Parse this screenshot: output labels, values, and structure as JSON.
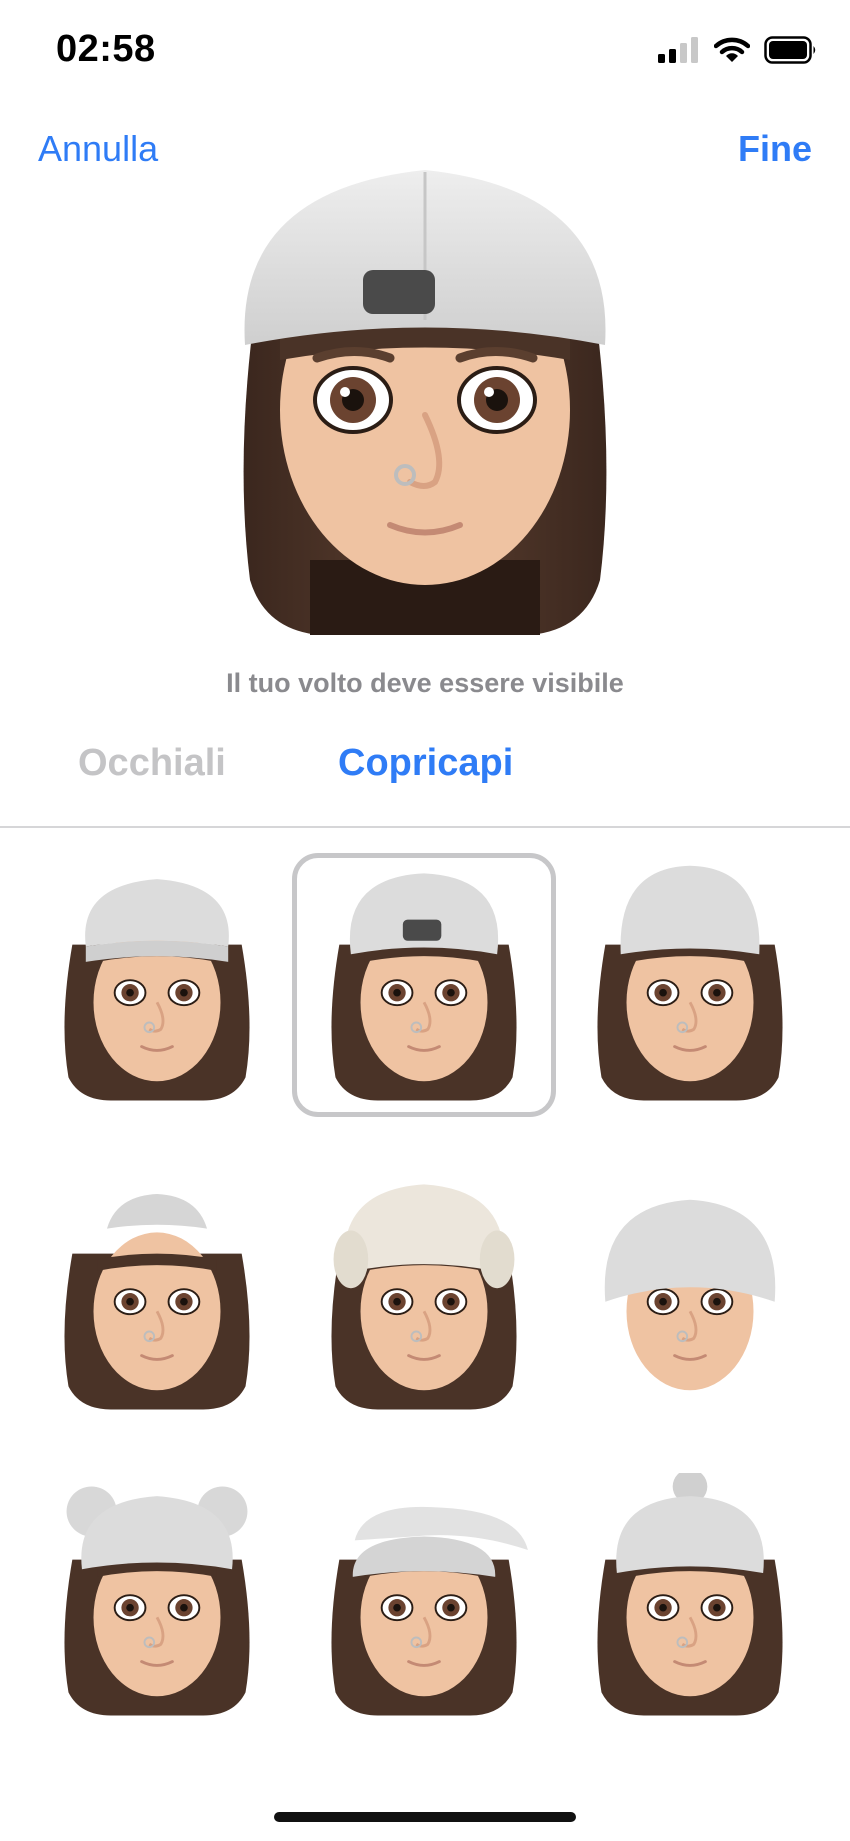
{
  "status_bar": {
    "time": "02:58",
    "signal_icon": "cellular-signal-icon",
    "wifi_icon": "wifi-icon",
    "battery_icon": "battery-icon"
  },
  "nav": {
    "cancel_label": "Annulla",
    "done_label": "Fine"
  },
  "preview": {
    "hint": "Il tuo volto deve essere visibile",
    "hat": "backwards-cap"
  },
  "tabs": [
    {
      "label": "Occhiali",
      "selected": false
    },
    {
      "label": "Copricapi",
      "selected": true
    }
  ],
  "headwear_options": [
    {
      "name": "beanie",
      "hair": true,
      "selected": false
    },
    {
      "name": "backwards-cap",
      "hair": true,
      "selected": true
    },
    {
      "name": "tall-beanie",
      "hair": true,
      "selected": false
    },
    {
      "name": "small-cap",
      "hair": true,
      "selected": false
    },
    {
      "name": "earflap-hat",
      "hair": true,
      "selected": false
    },
    {
      "name": "fitted-beanie",
      "hair": false,
      "selected": false
    },
    {
      "name": "bear-ears-beanie",
      "hair": true,
      "selected": false
    },
    {
      "name": "slouchy-hat",
      "hair": true,
      "selected": false
    },
    {
      "name": "pompom-beanie",
      "hair": true,
      "selected": false
    }
  ],
  "colors": {
    "accent": "#2f7cf6",
    "inactive_tab": "#c4c4c6",
    "hint": "#8a8a8e",
    "hat": "#dcdcdc",
    "skin": "#efc3a2",
    "hair": "#4a3327"
  }
}
